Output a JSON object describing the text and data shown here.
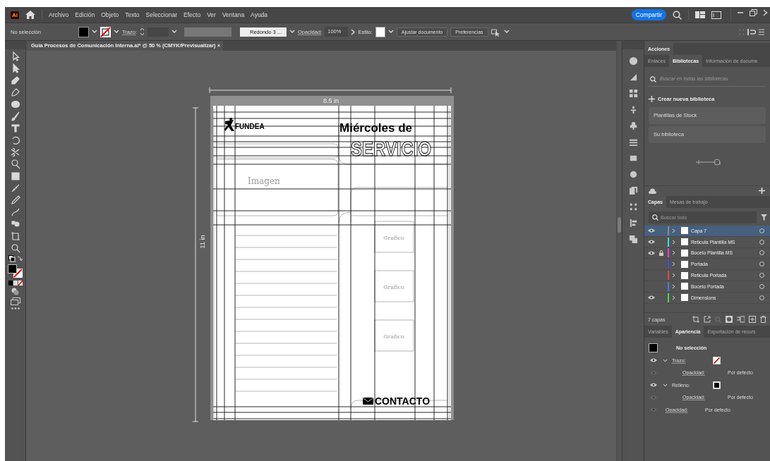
{
  "app": {
    "logo": "Ai"
  },
  "menu": [
    "Archivo",
    "Edición",
    "Objeto",
    "Texto",
    "Seleccionar",
    "Efecto",
    "Ver",
    "Ventana",
    "Ayuda"
  ],
  "share_button": "Compartir",
  "control_bar": {
    "selection": "No selección",
    "stroke_label": "Trazo:",
    "brush": "Redondo 3 ...",
    "opacity_label": "Opacidad:",
    "opacity": "100%",
    "style_label": "Estilo:",
    "buttons": [
      "Ajustar documento",
      "Preferencias"
    ]
  },
  "document_tab": {
    "title": "Guía Procesos de Comunicación Interna.ai* @ 50 % (CMYK/Previsualizar)",
    "close": "×"
  },
  "artboard": {
    "width_label": "8.5 in",
    "height_label": "11 in",
    "logo_text": "FUNDEA",
    "heading": "Miércoles de",
    "heading_outline": "SERVICIO",
    "image_note": "Imagen",
    "chart_notes": [
      "Grafico",
      "Grafico",
      "Grafico"
    ],
    "contact": "CONTACTO"
  },
  "actions_panel": {
    "tab": "Acciones"
  },
  "libraries_panel": {
    "tabs": [
      {
        "label": "Enlaces",
        "selected": false
      },
      {
        "label": "Bibliotecas",
        "selected": true
      },
      {
        "label": "Información de docume",
        "selected": false
      }
    ],
    "search": {
      "placeholder": "Buscar en todas las bibliotecas"
    },
    "create": "Crear nueva biblioteca",
    "items": [
      "Plantillas de Stock",
      "Su biblioteca"
    ]
  },
  "layers_panel": {
    "tabs": [
      {
        "label": "Capas",
        "selected": true
      },
      {
        "label": "Mesas de trabajo",
        "selected": false
      }
    ],
    "search": {
      "placeholder": "Buscar todo"
    },
    "layers": [
      {
        "name": "Capa 7",
        "color": "#8a8a8a",
        "visible": true,
        "locked": false,
        "selected": true
      },
      {
        "name": "Reticula Plantilla MS",
        "color": "#33e0e0",
        "visible": true,
        "locked": false,
        "selected": false
      },
      {
        "name": "Boceto Plantilla MS",
        "color": "#e040e0",
        "visible": true,
        "locked": true,
        "selected": false
      },
      {
        "name": "Portada",
        "color": "#4a4af0",
        "visible": false,
        "locked": false,
        "selected": false
      },
      {
        "name": "Reticula Portada",
        "color": "#e04848",
        "visible": false,
        "locked": false,
        "selected": false
      },
      {
        "name": "Boceto Portada",
        "color": "#4a78f0",
        "visible": false,
        "locked": false,
        "selected": false
      },
      {
        "name": "Dimensions",
        "color": "#40e040",
        "visible": true,
        "locked": false,
        "selected": false
      }
    ],
    "count": "7 capas"
  },
  "appearance_panel": {
    "tabs": [
      {
        "label": "Variables",
        "selected": false
      },
      {
        "label": "Apariencia",
        "selected": true
      },
      {
        "label": "Exportación de recurs",
        "selected": false
      }
    ],
    "title": "No selección",
    "rows": [
      {
        "kind": "stroke",
        "label": "Trazo:",
        "visible": true
      },
      {
        "kind": "sub-opacity",
        "label": "Opacidad:",
        "value": "Por defecto",
        "visible": false
      },
      {
        "kind": "fill",
        "label": "Relleno:",
        "visible": true
      },
      {
        "kind": "sub-opacity",
        "label": "Opacidad:",
        "value": "Por defecto",
        "visible": false
      },
      {
        "kind": "opacity",
        "label": "Opacidad:",
        "value": "Por defecto",
        "visible": false
      }
    ]
  }
}
